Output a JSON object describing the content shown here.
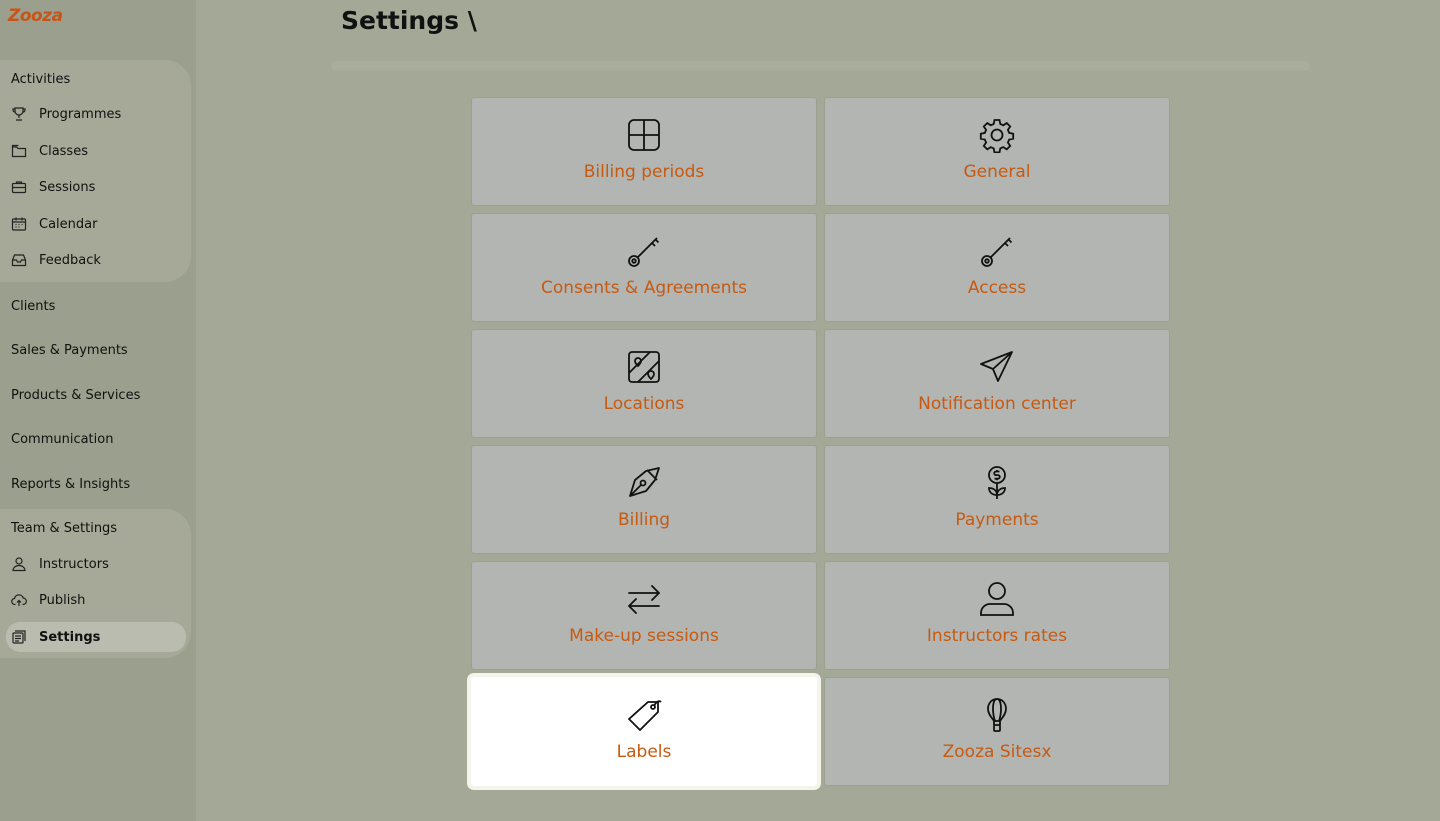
{
  "app": {
    "logo_text": "Zooza",
    "accent_color": "#c75a10"
  },
  "page": {
    "title": "Settings \\"
  },
  "sidebar": {
    "top_items": {
      "activities": "Activities",
      "clients": "Clients",
      "sales": "Sales & Payments",
      "products": "Products & Services",
      "communication": "Communication",
      "reports": "Reports & Insights",
      "team": "Team & Settings"
    },
    "activities_items": [
      {
        "label": "Programmes",
        "icon": "trophy-icon"
      },
      {
        "label": "Classes",
        "icon": "folder-icon"
      },
      {
        "label": "Sessions",
        "icon": "briefcase-icon"
      },
      {
        "label": "Calendar",
        "icon": "calendar-icon"
      },
      {
        "label": "Feedback",
        "icon": "inbox-icon"
      }
    ],
    "team_items": [
      {
        "label": "Instructors",
        "icon": "user-icon"
      },
      {
        "label": "Publish",
        "icon": "cloud-upload-icon"
      },
      {
        "label": "Settings",
        "icon": "settings-icon",
        "active": true
      }
    ]
  },
  "cards": [
    {
      "label": "Billing periods",
      "icon": "grid-icon"
    },
    {
      "label": "General",
      "icon": "gear-icon"
    },
    {
      "label": "Consents & Agreements",
      "icon": "key-icon"
    },
    {
      "label": "Access",
      "icon": "key-icon"
    },
    {
      "label": "Locations",
      "icon": "map-icon"
    },
    {
      "label": "Notification center",
      "icon": "paper-plane-icon"
    },
    {
      "label": "Billing",
      "icon": "pen-nib-icon"
    },
    {
      "label": "Payments",
      "icon": "money-flower-icon"
    },
    {
      "label": "Make-up sessions",
      "icon": "arrows-swap-icon"
    },
    {
      "label": "Instructors rates",
      "icon": "user-icon"
    },
    {
      "label": "Labels",
      "icon": "tag-icon",
      "highlighted": true
    },
    {
      "label": "Zooza Sitesx",
      "icon": "hot-air-balloon-icon"
    }
  ]
}
